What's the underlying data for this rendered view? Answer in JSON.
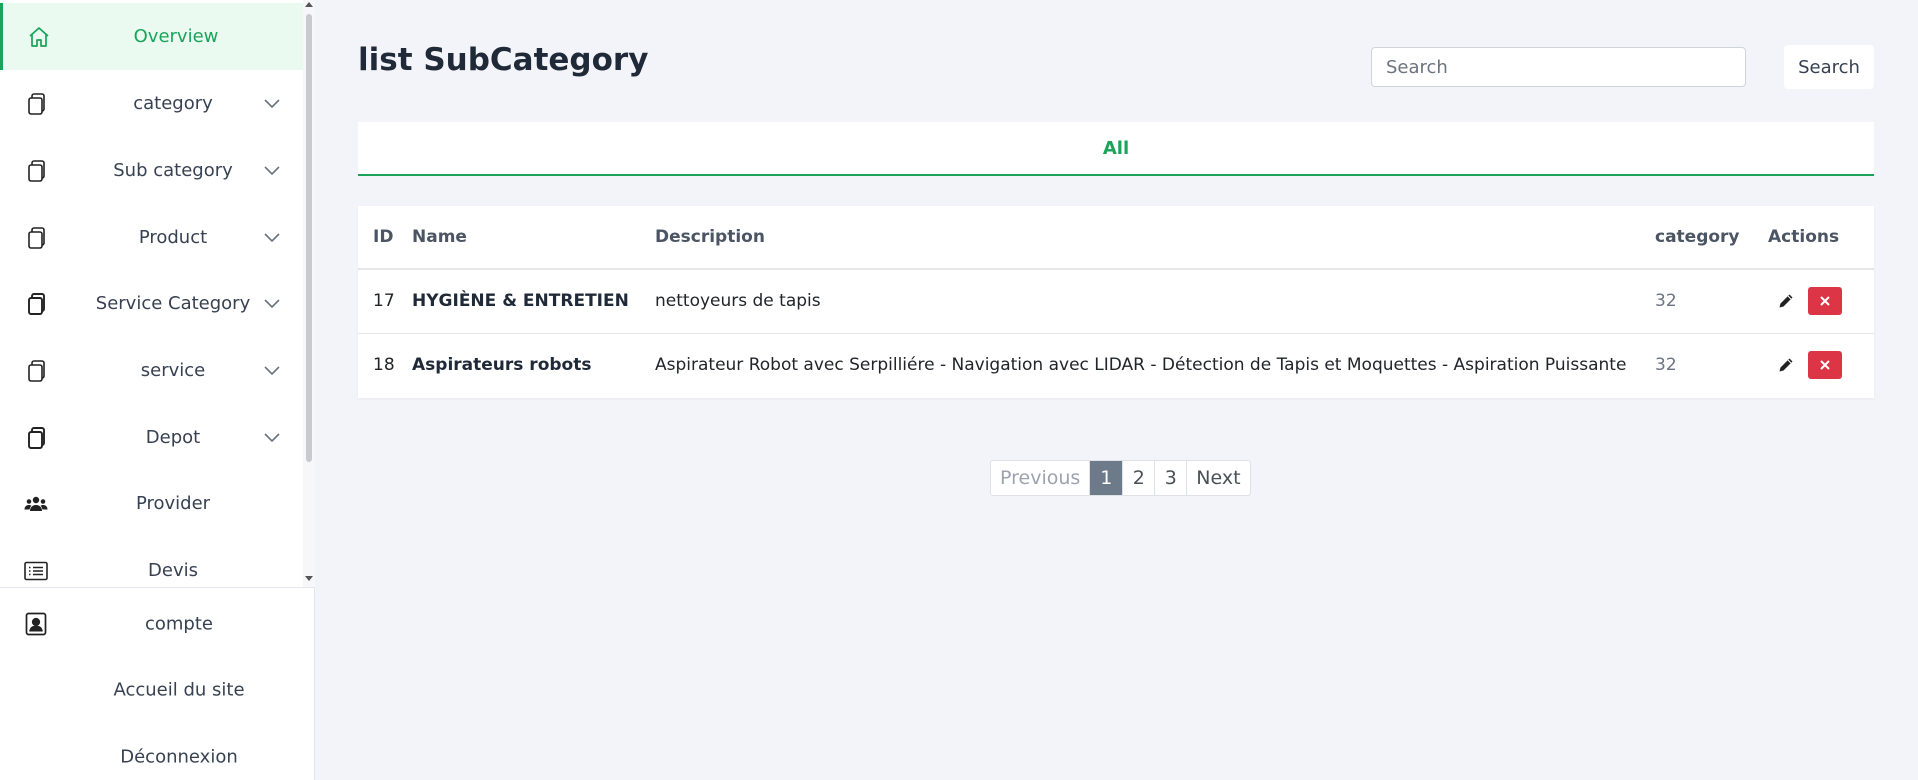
{
  "sidebar": {
    "items": [
      {
        "label": "Overview",
        "icon": "home-icon",
        "active": true,
        "chevron": false
      },
      {
        "label": "category",
        "icon": "copy-icon",
        "chevron": true
      },
      {
        "label": "Sub category",
        "icon": "copy-icon",
        "chevron": true
      },
      {
        "label": "Product",
        "icon": "copy-icon",
        "chevron": true
      },
      {
        "label": "Service Category",
        "icon": "copy-icon",
        "chevron": true
      },
      {
        "label": "service",
        "icon": "copy-icon",
        "chevron": true
      },
      {
        "label": "Depot",
        "icon": "copy-icon",
        "chevron": true
      },
      {
        "label": "Provider",
        "icon": "people-icon",
        "chevron": false
      },
      {
        "label": "Devis",
        "icon": "list-icon",
        "chevron": false
      }
    ],
    "bottom": [
      {
        "label": "compte",
        "icon": "person-badge-icon"
      },
      {
        "label": "Accueil du site"
      },
      {
        "label": "Déconnexion"
      }
    ]
  },
  "main": {
    "title": "list SubCategory",
    "search": {
      "placeholder": "Search",
      "button_label": "Search"
    },
    "tabs": [
      {
        "label": "All",
        "active": true
      }
    ],
    "table": {
      "headers": {
        "id": "ID",
        "name": "Name",
        "description": "Description",
        "category": "category",
        "actions": "Actions"
      },
      "rows": [
        {
          "id": "17",
          "name": "HYGIÈNE & ENTRETIEN",
          "description": "nettoyeurs de tapis",
          "category": "32"
        },
        {
          "id": "18",
          "name": "Aspirateurs robots",
          "description": "Aspirateur Robot avec Serpilliére - Navigation avec LIDAR - Détection de Tapis et Moquettes - Aspiration Puissante",
          "category": "32"
        }
      ]
    },
    "pagination": {
      "previous": "Previous",
      "pages": [
        "1",
        "2",
        "3"
      ],
      "current": "1",
      "next": "Next"
    }
  },
  "colors": {
    "accent": "#1aa35a",
    "danger": "#dc3545",
    "active_page": "#6c7a89",
    "background": "#f3f4fa"
  }
}
